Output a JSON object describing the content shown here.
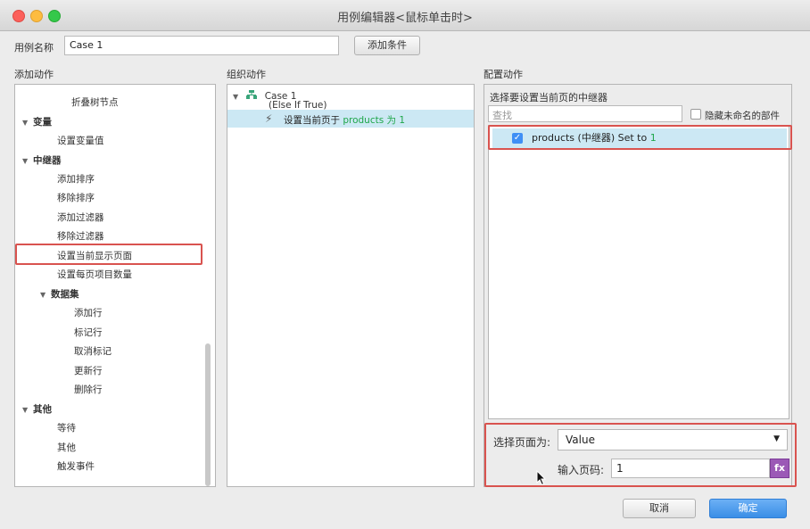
{
  "window": {
    "title": "用例编辑器<鼠标单击时>"
  },
  "case_name": {
    "label": "用例名称",
    "value": "Case 1",
    "add_condition": "添加条件"
  },
  "sections": {
    "add_actions": "添加动作",
    "organize_actions": "组织动作",
    "configure_actions": "配置动作"
  },
  "add_tree": {
    "items": [
      {
        "label": "折叠树节点"
      },
      {
        "label": "变量"
      },
      {
        "label": "设置变量值"
      },
      {
        "label": "中继器"
      },
      {
        "label": "添加排序"
      },
      {
        "label": "移除排序"
      },
      {
        "label": "添加过滤器"
      },
      {
        "label": "移除过滤器"
      },
      {
        "label": "设置当前显示页面"
      },
      {
        "label": "设置每页项目数量"
      },
      {
        "label": "数据集"
      },
      {
        "label": "添加行"
      },
      {
        "label": "标记行"
      },
      {
        "label": "取消标记"
      },
      {
        "label": "更新行"
      },
      {
        "label": "删除行"
      },
      {
        "label": "其他"
      },
      {
        "label": "等待"
      },
      {
        "label": "其他"
      },
      {
        "label": "触发事件"
      }
    ]
  },
  "organize": {
    "case_title": "Case 1",
    "case_condition": "(Else If True)",
    "action_prefix": "设置当前页于 ",
    "action_target": "products 为 1"
  },
  "configure": {
    "heading": "选择要设置当前页的中继器",
    "search_placeholder": "查找",
    "hide_unnamed": "隐藏未命名的部件",
    "repeater_item": "products (中继器) Set to ",
    "repeater_value": "1",
    "select_page_label": "选择页面为:",
    "select_page_value": "Value",
    "page_number_label": "输入页码:",
    "page_number_value": "1",
    "fx_label": "fx"
  },
  "footer": {
    "cancel": "取消",
    "ok": "确定"
  },
  "icons": {
    "expanded": "triangle-down-icon",
    "case": "case-node-icon",
    "action": "lightning-icon",
    "dropdown": "dropdown-arrow-icon",
    "cursor": "mouse-pointer-icon"
  },
  "colors": {
    "accent": "#4a90e2",
    "highlight": "#cce8f4",
    "annotation": "#d9534f",
    "value_green": "#1fa64a",
    "fx_purple": "#9b59b6"
  }
}
